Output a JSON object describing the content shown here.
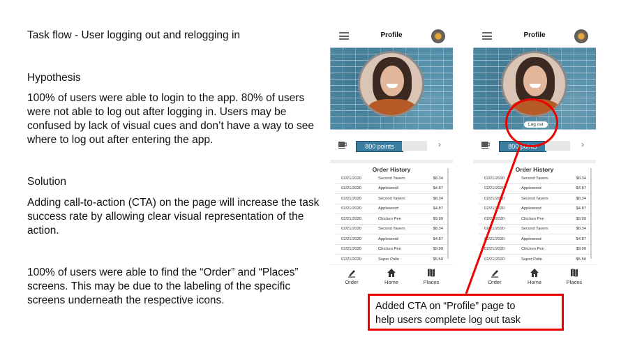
{
  "slide": {
    "title": "Task flow - User logging out and relogging in",
    "hypothesis_heading": "Hypothesis",
    "hypothesis_text": "100% of users were able to login to the app.  80% of users were not able to log out after logging in.  Users may be confused by lack of visual cues and don’t have a way to see where to log out after entering the app.",
    "solution_heading": "Solution",
    "solution_text": "Adding call-to-action (CTA) on the page will increase the task success rate by allowing clear visual representation of the action.",
    "findings_text": "100% of users were able to find the “Order” and “Places” screens.  This may be due to the labeling of the specific screens underneath the respective icons."
  },
  "phone": {
    "header_title": "Profile",
    "points_label": "800 points",
    "order_history_title": "Order History",
    "logout_label": "Log out",
    "orders": [
      {
        "date": "02/21/2020",
        "place": "Second Tavern",
        "amount": "$8.34"
      },
      {
        "date": "02/21/2020",
        "place": "Applewood",
        "amount": "$4.87"
      },
      {
        "date": "02/21/2020",
        "place": "Second Tavern",
        "amount": "$8.34"
      },
      {
        "date": "02/21/2020",
        "place": "Applewood",
        "amount": "$4.87"
      },
      {
        "date": "02/21/2020",
        "place": "Chicken Pen",
        "amount": "$9.99"
      },
      {
        "date": "02/21/2020",
        "place": "Second Tavern",
        "amount": "$8.34"
      },
      {
        "date": "02/21/2020",
        "place": "Applewood",
        "amount": "$4.87"
      },
      {
        "date": "02/21/2020",
        "place": "Chicken Pen",
        "amount": "$9.99"
      },
      {
        "date": "02/21/2020",
        "place": "Super Pollo",
        "amount": "$5.50"
      }
    ],
    "tabs": [
      {
        "label": "Order",
        "icon": "pencil-icon"
      },
      {
        "label": "Home",
        "icon": "home-icon"
      },
      {
        "label": "Places",
        "icon": "map-icon"
      }
    ]
  },
  "callout": {
    "text_line1": "Added CTA on “Profile” page to",
    "text_line2": "help users complete log out task"
  },
  "colors": {
    "accent": "#3b7ea2",
    "annotation": "#e00000"
  }
}
